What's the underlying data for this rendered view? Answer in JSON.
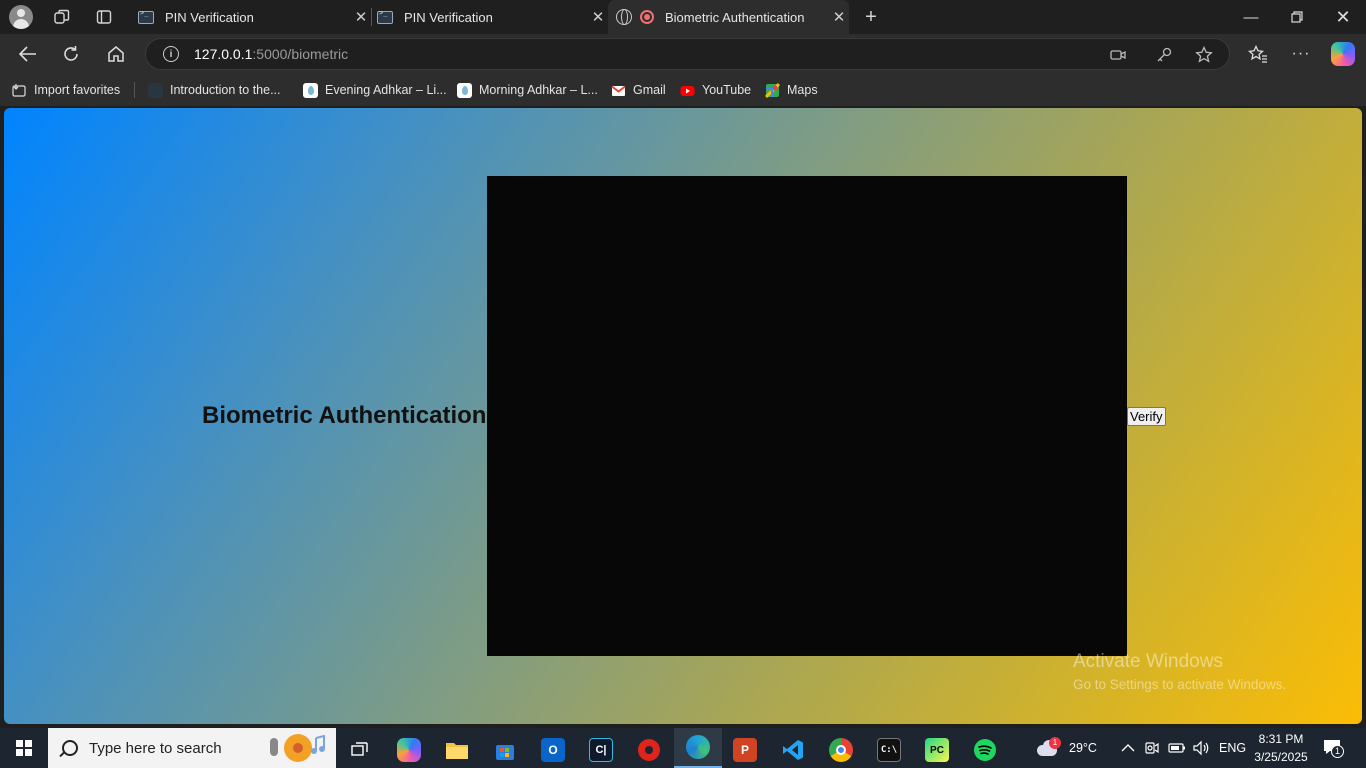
{
  "browser": {
    "tabs": [
      {
        "label": "PIN Verification",
        "active": false
      },
      {
        "label": "PIN Verification",
        "active": false
      },
      {
        "label": "Biometric Authentication",
        "active": true
      }
    ],
    "address": {
      "host": "127.0.0.1",
      "path": ":5000/biometric"
    },
    "bookmarks": [
      {
        "label": "Import favorites",
        "icon": "import-icon"
      },
      {
        "label": "Introduction to the...",
        "icon": "page-icon"
      },
      {
        "label": "Evening Adhkar – Li...",
        "icon": "droplet-icon"
      },
      {
        "label": "Morning Adhkar – L...",
        "icon": "droplet-icon"
      },
      {
        "label": "Gmail",
        "icon": "gmail-icon"
      },
      {
        "label": "YouTube",
        "icon": "youtube-icon"
      },
      {
        "label": "Maps",
        "icon": "maps-icon"
      }
    ]
  },
  "page": {
    "heading": "Biometric Authentication",
    "verify_label": "Verify",
    "video_feed": "camera-video"
  },
  "watermark": {
    "line1": "Activate Windows",
    "line2": "Go to Settings to activate Windows."
  },
  "taskbar": {
    "search_placeholder": "Type here to search",
    "weather": "29°C",
    "language": "ENG",
    "time": "8:31 PM",
    "date": "3/25/2025",
    "notification_count": "1",
    "weather_badge": "1"
  },
  "colors": {
    "gradient_start": "#0084ff",
    "gradient_end": "#fbbd05",
    "video_bg": "#070707"
  }
}
